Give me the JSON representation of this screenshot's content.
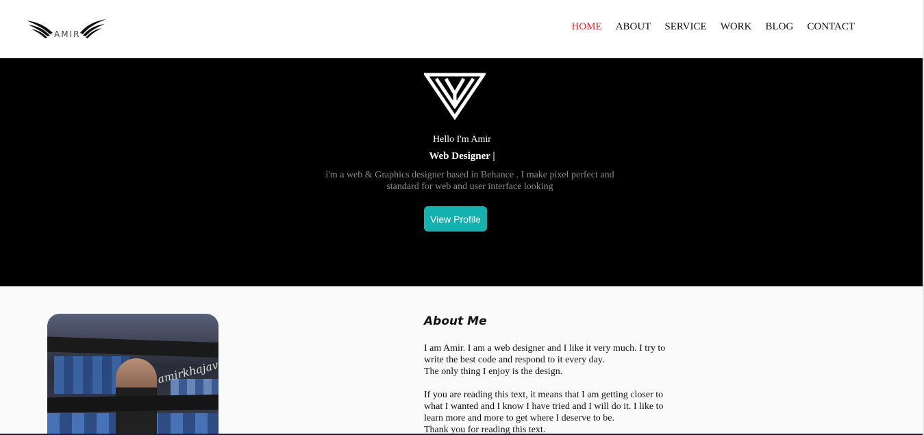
{
  "brand": {
    "logo_text": "AMIR"
  },
  "nav": {
    "items": [
      {
        "label": "HOME",
        "active": true
      },
      {
        "label": "ABOUT",
        "active": false
      },
      {
        "label": "SERVICE",
        "active": false
      },
      {
        "label": "WORK",
        "active": false
      },
      {
        "label": "BLOG",
        "active": false
      },
      {
        "label": "CONTACT",
        "active": false
      }
    ]
  },
  "hero": {
    "greeting": "Hello I'm Amir",
    "title": "Web Designer |",
    "description": "i'm a web & Graphics designer based in Behance . I make pixel perfect and standard for web and user interface looking",
    "button_label": "View Profile"
  },
  "about": {
    "title": "About Me",
    "paragraphs": {
      "p1_line1": "I am Amir. I am a web designer and I like it very much. I try to write the best code and respond to it every day.",
      "p1_line2": "The only thing I enjoy is the design.",
      "p2": "If you are reading this text, it means that I am getting closer to what I wanted and I know I have tried and I will do it. I like to learn more and more to get where I deserve to be.",
      "p3": "Thank you for reading this text."
    },
    "photo_caption": "amirkhajavi"
  },
  "colors": {
    "accent": "#14b1b1",
    "active_nav": "#e8222b",
    "hero_bg": "#000000"
  }
}
